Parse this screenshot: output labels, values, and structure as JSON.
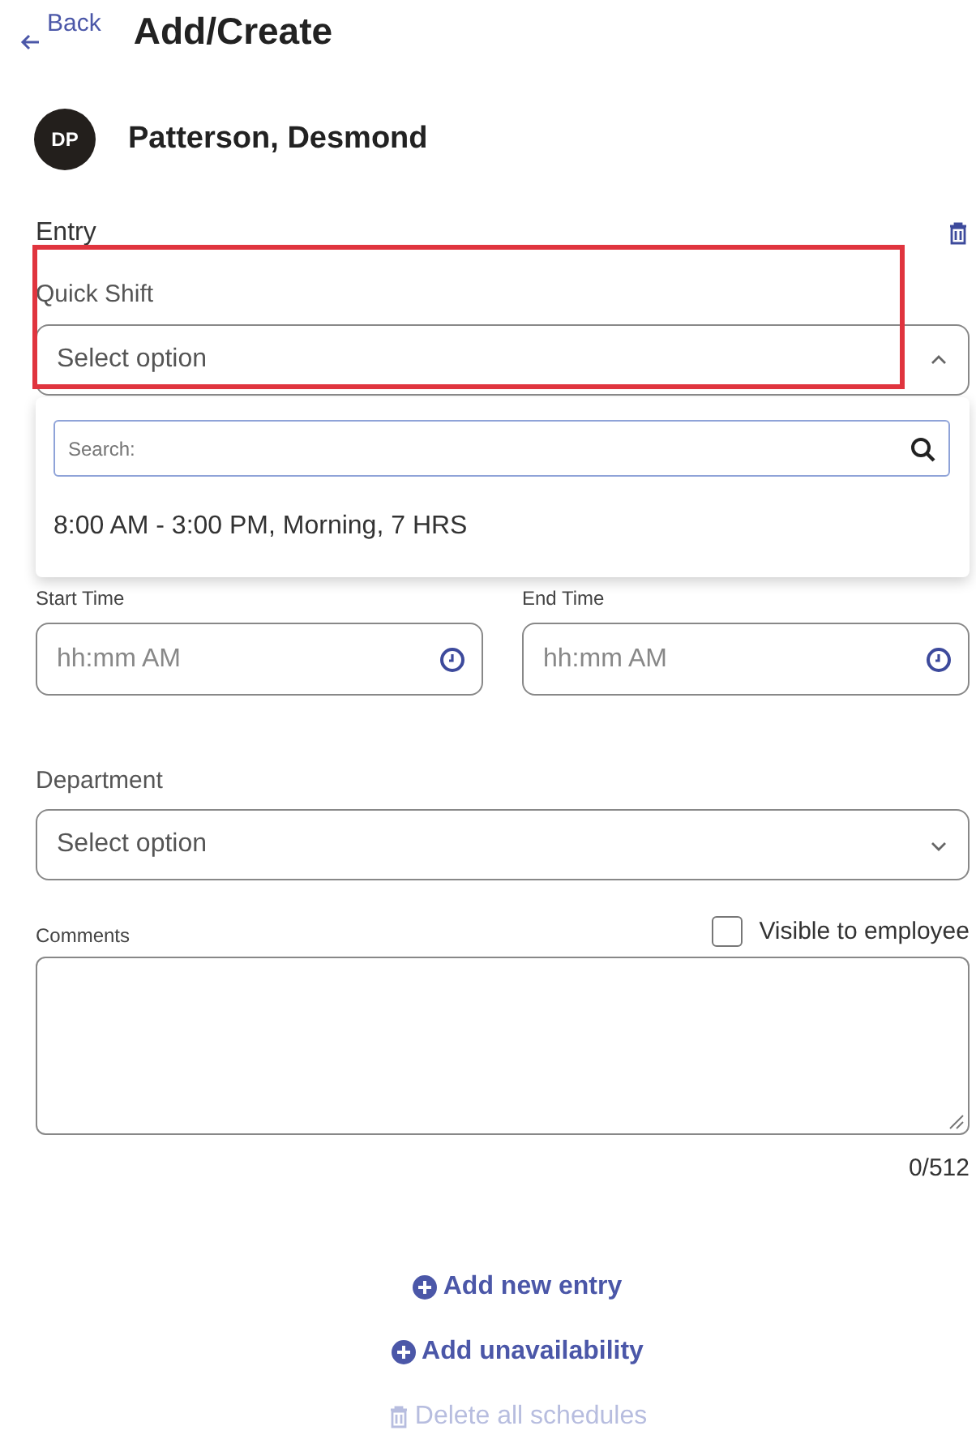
{
  "header": {
    "back_label": "Back",
    "title": "Add/Create"
  },
  "employee": {
    "initials": "DP",
    "name": "Patterson, Desmond"
  },
  "entry": {
    "heading": "Entry",
    "quick_shift": {
      "label": "Quick Shift",
      "placeholder": "Select option",
      "expanded": true,
      "highlighted": true,
      "search_placeholder": "Search:",
      "options": [
        "8:00 AM - 3:00 PM, Morning, 7 HRS"
      ]
    },
    "start_time": {
      "label": "Start Time",
      "placeholder": "hh:mm AM"
    },
    "end_time": {
      "label": "End Time",
      "placeholder": "hh:mm AM"
    },
    "department": {
      "label": "Department",
      "placeholder": "Select option",
      "expanded": false
    },
    "visible_to_employee": {
      "label": "Visible to employee",
      "checked": false
    },
    "comments": {
      "label": "Comments",
      "counter": "0/512"
    }
  },
  "actions": [
    {
      "label": "Add new entry",
      "kind": "add",
      "disabled": false
    },
    {
      "label": "Add unavailability",
      "kind": "add",
      "disabled": false
    },
    {
      "label": "Delete all schedules",
      "kind": "delete",
      "disabled": true
    }
  ]
}
